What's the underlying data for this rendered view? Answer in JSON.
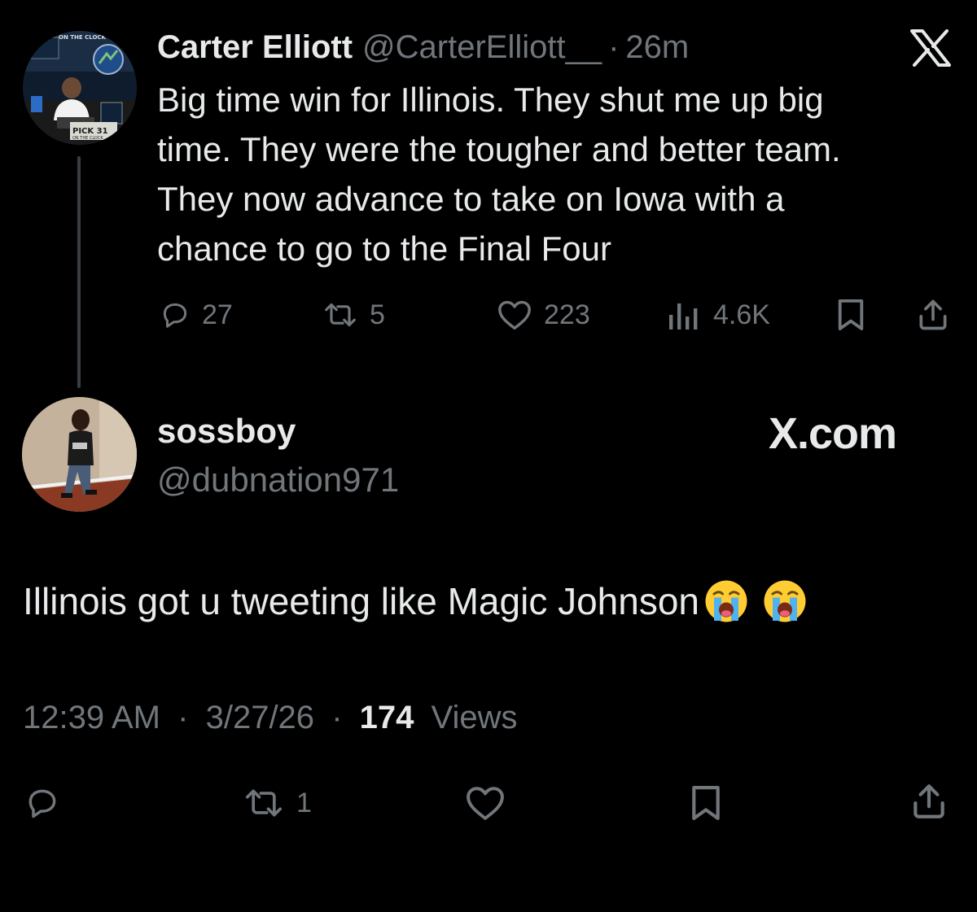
{
  "parent": {
    "author_name": "Carter Elliott",
    "author_handle": "@CarterElliott__",
    "separator": "·",
    "time": "26m",
    "avatar_overlay": {
      "top_left": "ON THE CLOCK",
      "bottom_left": "PICK 31",
      "bottom_sub": "ON THE CLOCK"
    },
    "text": "Big time win for Illinois. They shut me up big\ntime. They were the tougher and better team.\nThey now advance to take on Iowa with a\nchance to go to the Final Four",
    "actions": {
      "replies": "27",
      "reposts": "5",
      "likes": "223",
      "views": "4.6K"
    }
  },
  "reply": {
    "author_name": "sossboy",
    "author_handle": "@dubnation971",
    "site_label": "X.com",
    "text": "Illinois got u tweeting like Magic Johnson",
    "emojis": [
      "loudly-crying-face",
      "loudly-crying-face"
    ],
    "meta": {
      "time": "12:39 AM",
      "sep1": "·",
      "date": "3/27/26",
      "sep2": "·",
      "views_count": "174",
      "views_label": "Views"
    },
    "actions": {
      "reposts": "1"
    }
  },
  "colors": {
    "background": "#000000",
    "text_primary": "#e7e9ea",
    "text_secondary": "#71767b",
    "thread_line": "#3a3d41"
  }
}
